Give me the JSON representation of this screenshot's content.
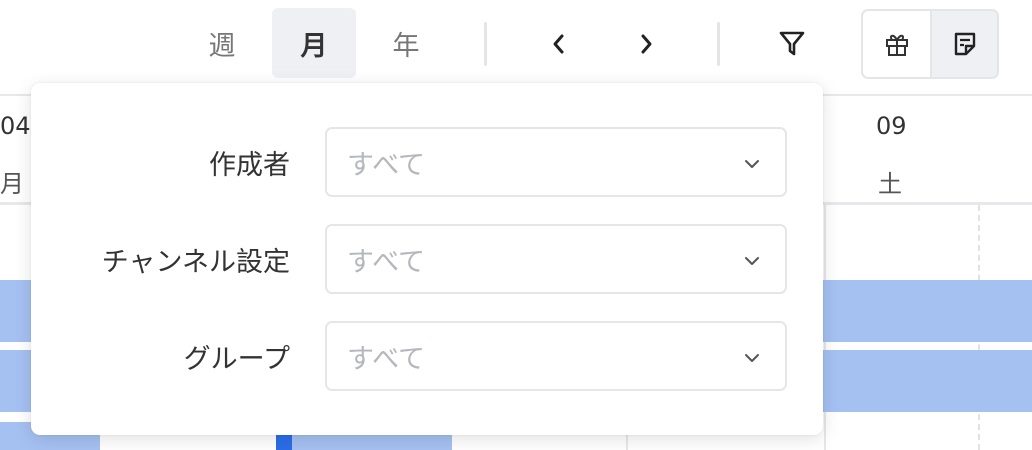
{
  "toolbar": {
    "views": [
      {
        "label": "週",
        "active": false
      },
      {
        "label": "月",
        "active": true
      },
      {
        "label": "年",
        "active": false
      }
    ],
    "prev_icon": "chevron-left-icon",
    "next_icon": "chevron-right-icon",
    "filter_icon": "filter-icon",
    "gift_icon": "gift-icon",
    "note_icon": "note-icon"
  },
  "calendar": {
    "left_day": {
      "date": "04",
      "weekday": "月"
    },
    "right_day": {
      "date": "09",
      "weekday": "土"
    },
    "bar_color": "#a5c1f2",
    "marker_color": "#2a6ee8"
  },
  "filter_popup": {
    "fields": [
      {
        "label": "作成者",
        "value": "すべて"
      },
      {
        "label": "チャンネル設定",
        "value": "すべて"
      },
      {
        "label": "グループ",
        "value": "すべて"
      }
    ]
  },
  "colors": {
    "active_bg": "#eef0f4",
    "border": "#e4e6ea",
    "placeholder": "#b4b7bd"
  }
}
